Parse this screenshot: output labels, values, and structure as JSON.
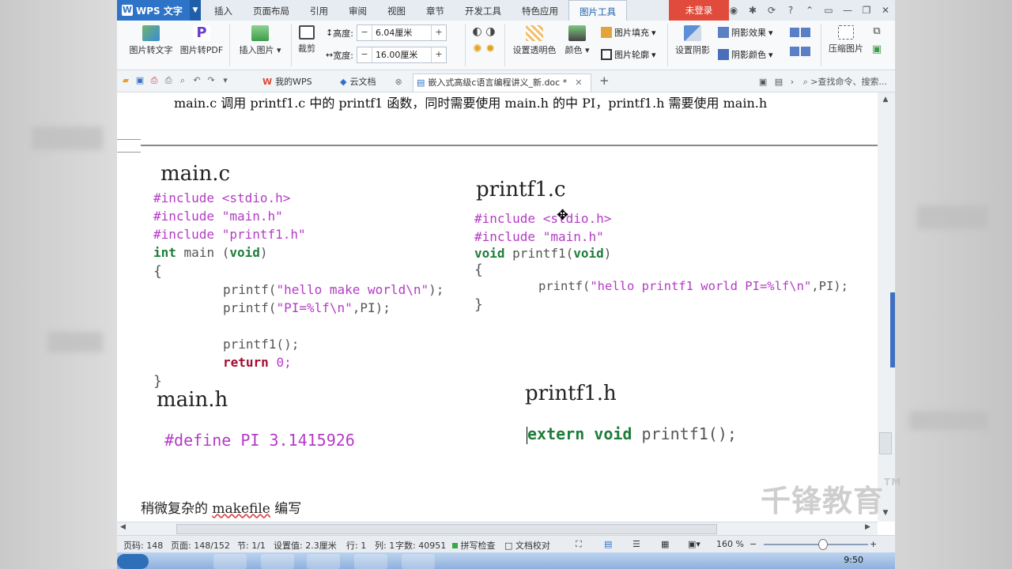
{
  "titlebar": {
    "app_menu": "WPS 文字",
    "tabs": [
      "插入",
      "页面布局",
      "引用",
      "审阅",
      "视图",
      "章节",
      "开发工具",
      "特色应用",
      "图片工具"
    ],
    "active_tab": "图片工具",
    "login": "未登录"
  },
  "ribbon": {
    "pic_to_text": "图片转文字",
    "pic_to_pdf": "图片转PDF",
    "insert_pic": "插入图片",
    "crop": "裁剪",
    "height_label": "高度:",
    "height_value": "6.04厘米",
    "width_label": "宽度:",
    "width_value": "16.00厘米",
    "set_transparent": "设置透明色",
    "color": "颜色",
    "fill": "图片填充",
    "outline": "图片轮廓",
    "set_shadow": "设置阴影",
    "shadow_effect": "阴影效果",
    "shadow_color": "阴影颜色",
    "compress": "压缩图片"
  },
  "quickbar": {
    "tab_mywps": "我的WPS",
    "tab_cloud": "云文档",
    "tab_doc": "嵌入式高级c语言编程讲义_新.doc *",
    "search": ">查找命令、搜索..."
  },
  "document": {
    "line1": "main.c 调用 printf1.c 中的 printf1 函数，同时需要使用 main.h 的中 PI，printf1.h 需要使用 main.h",
    "main_c": {
      "title": "main.c",
      "inc1_kw": "#include",
      "inc1_arg": "<stdio.h>",
      "inc2_kw": "#include",
      "inc2_arg": "\"main.h\"",
      "inc3_kw": "#include",
      "inc3_arg": "\"printf1.h\"",
      "sig_type": "int",
      "sig_name": "main",
      "sig_void": "void",
      "open": "{",
      "call1_fn": "printf(",
      "call1_str": "\"hello make world\\n\"",
      "call1_end": ");",
      "call2_fn": "printf(",
      "call2_str": "\"PI=%lf\\n\"",
      "call2_end": ",PI);",
      "call3": "printf1();",
      "ret_kw": "return",
      "ret_val": "0;",
      "close": "}"
    },
    "printf1_c": {
      "title": "printf1.c",
      "inc1_kw": "#include",
      "inc1_arg": "<stdio.h>",
      "inc2_kw": "#include",
      "inc2_arg": "\"main.h\"",
      "sig_type": "void",
      "sig_name": "printf1(",
      "sig_void": "void",
      "sig_end": ")",
      "open": "{",
      "call_fn": "printf(",
      "call_str": "\"hello printf1 world PI=%lf\\n\"",
      "call_end": ",PI);",
      "close": "}"
    },
    "main_h": {
      "title": "main.h",
      "define": "#define PI 3.1415926"
    },
    "printf1_h": {
      "title": "printf1.h",
      "extern_kw": "extern void",
      "decl": "printf1();"
    },
    "last_para_pre": "稍微复杂的 ",
    "last_para_word": "makefile",
    "last_para_post": " 编写"
  },
  "statusbar": {
    "page_code": "页码: 148",
    "page": "页面: 148/152",
    "section": "节: 1/1",
    "setting": "设置值: 2.3厘米",
    "row": "行: 1",
    "col": "列: 1",
    "words": "字数: 40951",
    "spell": "拼写检查",
    "proof": "文档校对",
    "zoom": "160 %"
  },
  "taskbar": {
    "time": "9:50"
  },
  "watermark": "千锋教育"
}
